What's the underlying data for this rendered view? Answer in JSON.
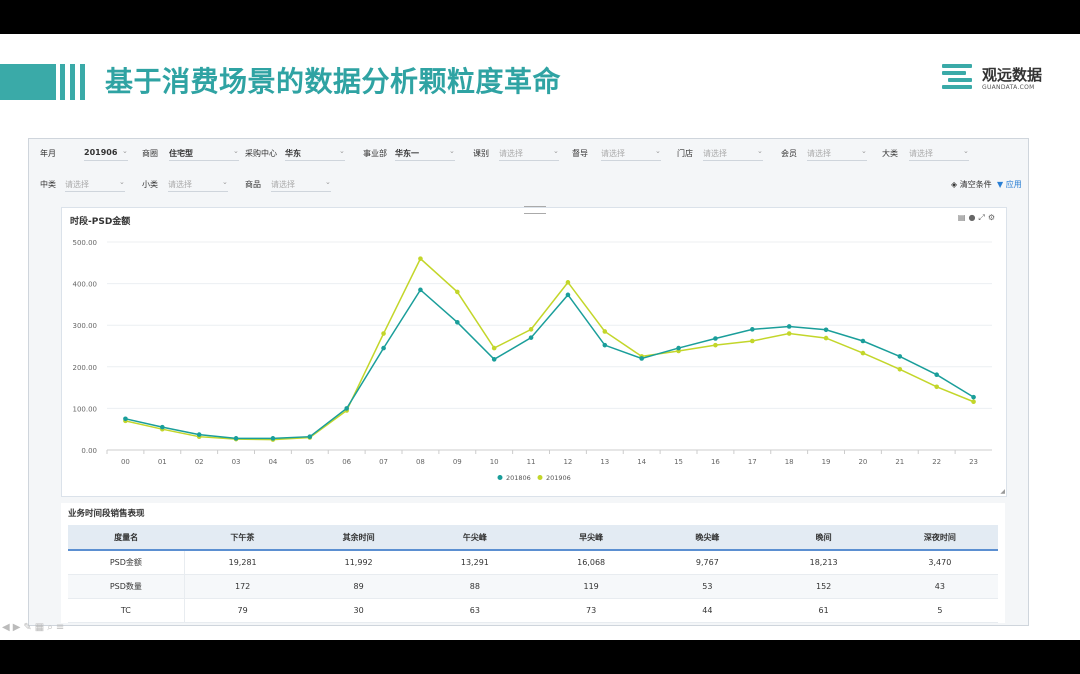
{
  "slide": {
    "title": "基于消费场景的数据分析颗粒度革命",
    "logo_name": "观远数据",
    "logo_sub": "GUANDATA.COM"
  },
  "filters": {
    "row1": [
      {
        "label": "年月",
        "value": "201906",
        "placeholder": false
      },
      {
        "label": "商圈",
        "value": "住宅型",
        "placeholder": false
      },
      {
        "label": "采购中心",
        "value": "华东",
        "placeholder": false
      },
      {
        "label": "事业部",
        "value": "华东一",
        "placeholder": false
      },
      {
        "label": "课别",
        "value": "请选择",
        "placeholder": true
      },
      {
        "label": "督导",
        "value": "请选择",
        "placeholder": true
      },
      {
        "label": "门店",
        "value": "请选择",
        "placeholder": true
      },
      {
        "label": "会员",
        "value": "请选择",
        "placeholder": true
      },
      {
        "label": "大类",
        "value": "请选择",
        "placeholder": true
      }
    ],
    "row2": [
      {
        "label": "中类",
        "value": "请选择",
        "placeholder": true
      },
      {
        "label": "小类",
        "value": "请选择",
        "placeholder": true
      },
      {
        "label": "商品",
        "value": "请选择",
        "placeholder": true
      }
    ],
    "clear_label": "清空条件",
    "apply_label": "应用"
  },
  "chart_card": {
    "title": "时段-PSD金额"
  },
  "chart_data": {
    "type": "line",
    "title": "时段-PSD金额",
    "x": [
      "00",
      "01",
      "02",
      "03",
      "04",
      "05",
      "06",
      "07",
      "08",
      "09",
      "10",
      "11",
      "12",
      "13",
      "14",
      "15",
      "16",
      "17",
      "18",
      "19",
      "20",
      "21",
      "22",
      "23"
    ],
    "ylim": [
      0,
      500
    ],
    "yticks": [
      "0.00",
      "100.00",
      "200.00",
      "300.00",
      "400.00",
      "500.00"
    ],
    "grid": true,
    "legend_position": "bottom",
    "series": [
      {
        "name": "201806",
        "color": "#1a9e9a",
        "values": [
          75,
          55,
          37,
          28,
          28,
          32,
          100,
          245,
          385,
          307,
          218,
          270,
          373,
          252,
          220,
          245,
          268,
          290,
          297,
          289,
          262,
          225,
          181,
          127
        ]
      },
      {
        "name": "201906",
        "color": "#c3d62a",
        "values": [
          70,
          50,
          32,
          26,
          25,
          30,
          95,
          280,
          460,
          380,
          245,
          290,
          403,
          285,
          225,
          238,
          252,
          262,
          280,
          269,
          233,
          194,
          152,
          116
        ]
      }
    ]
  },
  "table": {
    "title": "业务时间段销售表现",
    "columns": [
      "度量名",
      "下午茶",
      "其余时间",
      "午尖峰",
      "早尖峰",
      "晚尖峰",
      "晚间",
      "深夜时间"
    ],
    "rows": [
      [
        "PSD金额",
        "19,281",
        "11,992",
        "13,291",
        "16,068",
        "9,767",
        "18,213",
        "3,470"
      ],
      [
        "PSD数量",
        "172",
        "89",
        "88",
        "119",
        "53",
        "152",
        "43"
      ],
      [
        "TC",
        "79",
        "30",
        "63",
        "73",
        "44",
        "61",
        "5"
      ]
    ]
  }
}
